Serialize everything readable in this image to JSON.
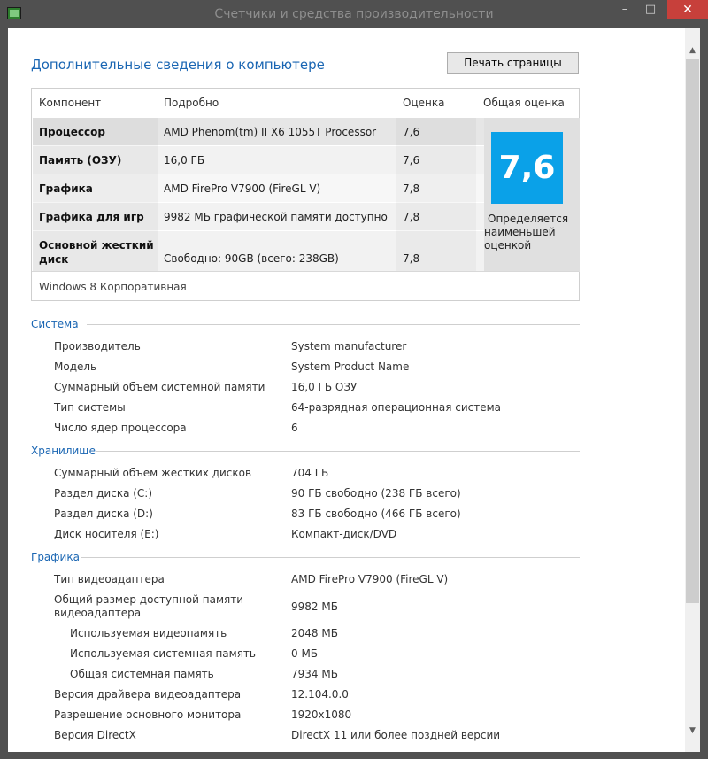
{
  "window": {
    "title": "Счетчики и средства производительности",
    "min": "–",
    "max": "□",
    "close": "✕"
  },
  "page": {
    "heading": "Дополнительные сведения о компьютере",
    "print_button": "Печать страницы"
  },
  "score_table": {
    "headers": [
      "Компонент",
      "Подробно",
      "Оценка",
      "Общая оценка"
    ],
    "rows": [
      {
        "name": "Процессор",
        "detail": "AMD Phenom(tm) II X6 1055T Processor",
        "score": "7,6"
      },
      {
        "name": "Память (ОЗУ)",
        "detail": "16,0 ГБ",
        "score": "7,6"
      },
      {
        "name": "Графика",
        "detail": "AMD FirePro V7900 (FireGL V)",
        "score": "7,8"
      },
      {
        "name": "Графика для игр",
        "detail": "9982 МБ графической памяти доступно",
        "score": "7,8"
      },
      {
        "name_line1": "Основной жесткий",
        "name_line2": "диск",
        "detail": "Свободно: 90GB (всего: 238GB)",
        "score": "7,8"
      }
    ],
    "overall_score": "7,6",
    "overall_note": [
      "Определяется",
      "наименьшей",
      "оценкой"
    ],
    "os": "Windows 8 Корпоративная",
    "tile_color": "#0aa1e8"
  },
  "sections": {
    "system": {
      "title": "Система",
      "rows": [
        {
          "k": "Производитель",
          "v": "System manufacturer"
        },
        {
          "k": "Модель",
          "v": "System Product Name"
        },
        {
          "k": "Суммарный объем системной памяти",
          "v": "16,0 ГБ ОЗУ"
        },
        {
          "k": "Тип системы",
          "v": "64-разрядная операционная система"
        },
        {
          "k": "Число ядер процессора",
          "v": "6"
        }
      ]
    },
    "storage": {
      "title": "Хранилище",
      "rows": [
        {
          "k": "Суммарный объем жестких дисков",
          "v": "704 ГБ"
        },
        {
          "k": "Раздел диска (C:)",
          "v": "90 ГБ свободно (238 ГБ всего)"
        },
        {
          "k": "Раздел диска (D:)",
          "v": "83 ГБ свободно (466 ГБ всего)"
        },
        {
          "k": "Диск носителя (E:)",
          "v": "Компакт-диск/DVD"
        }
      ]
    },
    "graphics": {
      "title": "Графика",
      "rows": [
        {
          "k": "Тип видеоадаптера",
          "v": "AMD FirePro V7900 (FireGL V)"
        },
        {
          "k1": "Общий размер доступной памяти",
          "k2": "видеоадаптера",
          "v": "9982 МБ"
        },
        {
          "k": "Используемая видеопамять",
          "v": "2048 МБ"
        },
        {
          "k": "Используемая системная память",
          "v": "0 МБ"
        },
        {
          "k": "Общая системная память",
          "v": "7934 МБ"
        },
        {
          "k": "Версия драйвера видеоадаптера",
          "v": "12.104.0.0"
        },
        {
          "k": "Разрешение основного монитора",
          "v": "1920x1080"
        },
        {
          "k": "Версия DirectX",
          "v": "DirectX 11 или более поздней версии"
        }
      ]
    }
  }
}
